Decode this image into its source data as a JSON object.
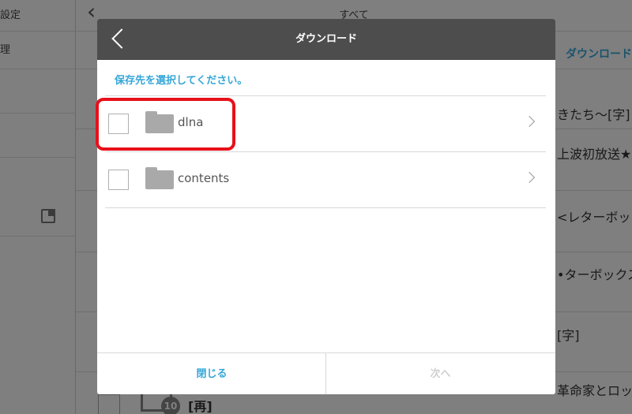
{
  "background": {
    "sidebar": {
      "items": [
        "設定",
        "理"
      ]
    },
    "header": {
      "title": "すべて"
    },
    "tabs": {
      "download": "ダウンロード"
    },
    "rows": [
      {
        "text": "きたち〜[字]"
      },
      {
        "text": "上波初放送★["
      },
      {
        "text": "<レターボッ"
      },
      {
        "text": "•ターボックス"
      },
      {
        "text": "[字]"
      },
      {
        "text": "革命家とロッ"
      }
    ],
    "last_item": {
      "badge": "10",
      "text": "[再]"
    }
  },
  "modal": {
    "title": "ダウンロード",
    "subtitle": "保存先を選択してください。",
    "folders": [
      {
        "name": "dlna",
        "checked": false,
        "highlighted": true
      },
      {
        "name": "contents",
        "checked": false,
        "highlighted": false
      }
    ],
    "footer": {
      "close_label": "閉じる",
      "next_label": "次へ",
      "next_enabled": false
    }
  },
  "colors": {
    "accent": "#35a7d8",
    "header_bg": "#4d4d4d",
    "highlight": "#e8101a",
    "disabled": "#d0d0d0"
  }
}
